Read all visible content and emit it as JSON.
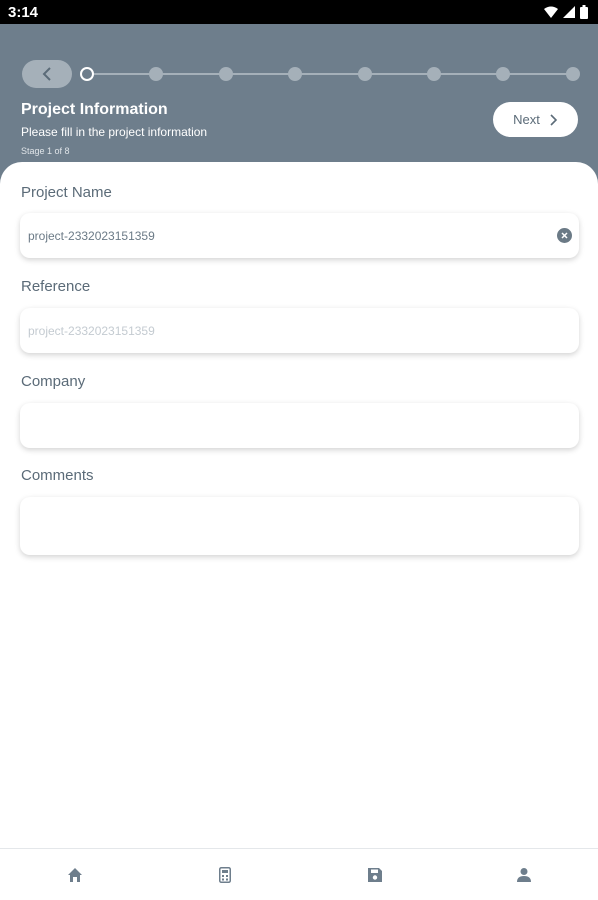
{
  "status_bar": {
    "time": "3:14"
  },
  "header": {
    "title": "Project Information",
    "subtitle": "Please fill in the project information",
    "stage": "Stage 1 of 8",
    "next_label": "Next",
    "steps_total": 8,
    "current_step": 1
  },
  "form": {
    "project_name": {
      "label": "Project Name",
      "value": "project-2332023151359"
    },
    "reference": {
      "label": "Reference",
      "placeholder": "project-2332023151359"
    },
    "company": {
      "label": "Company",
      "value": ""
    },
    "comments": {
      "label": "Comments",
      "value": ""
    }
  },
  "bottom_nav": {
    "items": [
      {
        "icon": "home-icon"
      },
      {
        "icon": "calculator-icon",
        "active": true
      },
      {
        "icon": "save-icon"
      },
      {
        "icon": "person-icon"
      }
    ]
  },
  "colors": {
    "header_bg": "#6e7e8c",
    "accent_muted": "#a5b0b9",
    "label_text": "#5b6b78"
  }
}
